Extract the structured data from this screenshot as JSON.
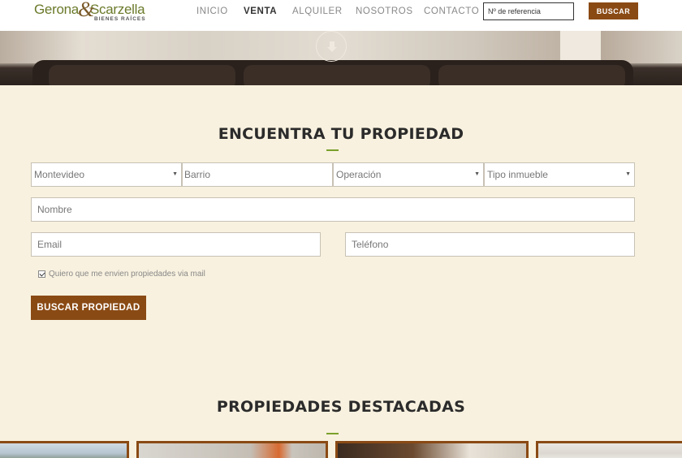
{
  "brand": {
    "name_left": "Gerona",
    "ampersand": "&",
    "name_right": "Scarzella",
    "tagline": "BIENES RAÍCES"
  },
  "nav": {
    "items": [
      {
        "label": "INICIO",
        "active": false
      },
      {
        "label": "VENTA",
        "active": true
      },
      {
        "label": "ALQUILER",
        "active": false
      },
      {
        "label": "NOSOTROS",
        "active": false
      },
      {
        "label": "CONTACTO",
        "active": false
      }
    ],
    "ref_placeholder": "Nº de referencia",
    "search_label": "BUSCAR"
  },
  "hero": {
    "scroll_icon": "arrow-down-icon"
  },
  "search": {
    "title": "ENCUENTRA TU PROPIEDAD",
    "department": "Montevideo",
    "barrio_placeholder": "Barrio",
    "operation": "Operación",
    "property_type": "Tipo inmueble",
    "name_placeholder": "Nombre",
    "email_placeholder": "Email",
    "phone_placeholder": "Teléfono",
    "newsletter_label": "Quiero que me envien propiedades via mail",
    "newsletter_checked": true,
    "submit_label": "BUSCAR PROPIEDAD"
  },
  "featured": {
    "title": "PROPIEDADES DESTACADAS"
  },
  "colors": {
    "accent_brown": "#8a4a14",
    "accent_green": "#7aa02a",
    "background": "#f8f1df",
    "logo_green": "#6a7a2a"
  }
}
